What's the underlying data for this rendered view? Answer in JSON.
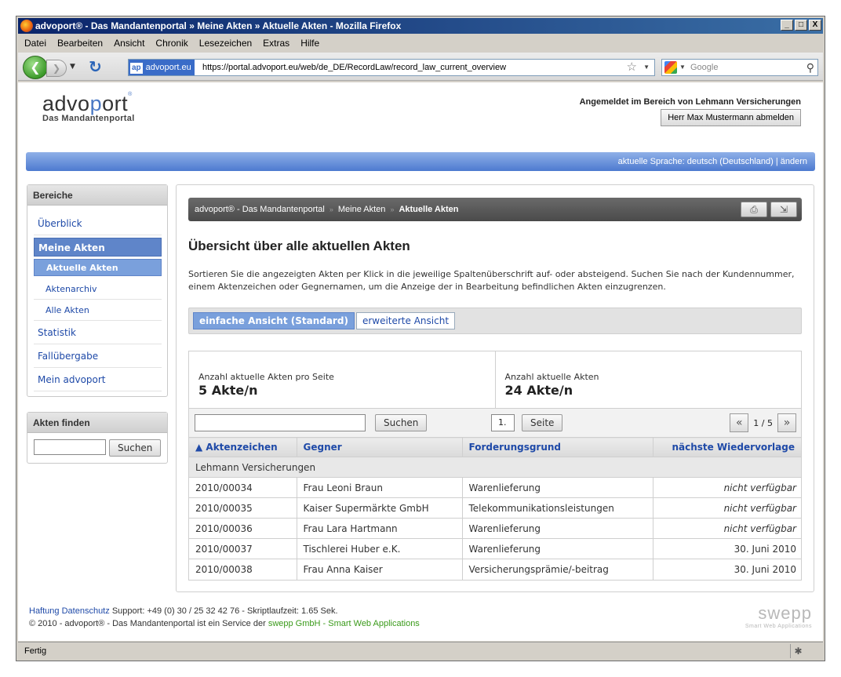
{
  "window": {
    "title": "advoport® - Das Mandantenportal  »  Meine Akten  »  Aktuelle Akten - Mozilla Firefox",
    "controls": [
      "_",
      "□",
      "X"
    ]
  },
  "menu": [
    "Datei",
    "Bearbeiten",
    "Ansicht",
    "Chronik",
    "Lesezeichen",
    "Extras",
    "Hilfe"
  ],
  "browser": {
    "site_badge": "ap",
    "site_name": "advoport.eu",
    "url": "https://portal.advoport.eu/web/de_DE/RecordLaw/record_law_current_overview",
    "search_placeholder": "Google",
    "status": "Fertig"
  },
  "header": {
    "logo_word_a": "advo",
    "logo_word_b": "p",
    "logo_word_c": "ort",
    "logo_reg": "®",
    "logo_sub": "Das Mandantenportal",
    "logged_in": "Angemeldet im Bereich von Lehmann Versicherungen",
    "logout_label": "Herr Max Mustermann abmelden",
    "language": "aktuelle Sprache: deutsch (Deutschland) | ändern"
  },
  "sidebar": {
    "areas_title": "Bereiche",
    "items": [
      {
        "label": "Überblick"
      },
      {
        "label": "Meine Akten"
      },
      {
        "label": "Aktuelle Akten"
      },
      {
        "label": "Aktenarchiv"
      },
      {
        "label": "Alle Akten"
      },
      {
        "label": "Statistik"
      },
      {
        "label": "Fallübergabe"
      },
      {
        "label": "Mein advoport"
      }
    ],
    "finder_title": "Akten finden",
    "finder_button": "Suchen"
  },
  "main": {
    "breadcrumb": [
      "advoport® - Das Mandantenportal",
      "Meine Akten",
      "Aktuelle Akten"
    ],
    "breadcrumb_sep": "»",
    "title": "Übersicht über alle aktuellen Akten",
    "intro": "Sortieren Sie die angezeigten Akten per Klick in die jeweilige Spaltenüberschrift auf- oder absteigend. Suchen Sie nach der Kundennummer, einem Aktenzeichen oder Gegnernamen, um die Anzeige der in Bearbeitung befindlichen Akten einzugrenzen.",
    "tabs": [
      "einfache Ansicht (Standard)",
      "erweiterte Ansicht"
    ],
    "stats": {
      "per_page_label": "Anzahl aktuelle Akten pro Seite",
      "per_page_value": "5 Akte/n",
      "total_label": "Anzahl aktuelle Akten",
      "total_value": "24 Akte/n"
    },
    "search_button": "Suchen",
    "page_input": "1.",
    "page_button": "Seite",
    "pager_prev": "«",
    "pager_info": "1 / 5",
    "pager_next": "»",
    "columns": [
      "▲ Aktenzeichen",
      "Gegner",
      "Forderungsgrund",
      "nächste Wiedervorlage"
    ],
    "group": "Lehmann Versicherungen",
    "rows": [
      {
        "az": "2010/00034",
        "gegner": "Frau Leoni Braun",
        "grund": "Warenlieferung",
        "wv": "nicht verfügbar",
        "na": true
      },
      {
        "az": "2010/00035",
        "gegner": "Kaiser Supermärkte GmbH",
        "grund": "Telekommunikationsleistungen",
        "wv": "nicht verfügbar",
        "na": true
      },
      {
        "az": "2010/00036",
        "gegner": "Frau Lara Hartmann",
        "grund": "Warenlieferung",
        "wv": "nicht verfügbar",
        "na": true
      },
      {
        "az": "2010/00037",
        "gegner": "Tischlerei Huber e.K.",
        "grund": "Warenlieferung",
        "wv": "30. Juni 2010",
        "na": false
      },
      {
        "az": "2010/00038",
        "gegner": "Frau Anna Kaiser",
        "grund": "Versicherungsprämie/-beitrag",
        "wv": "30. Juni 2010",
        "na": false
      }
    ]
  },
  "footer": {
    "link_haftung": "Haftung",
    "link_datenschutz": "Datenschutz",
    "support": "Support: +49 (0) 30 / 25 32 42 76 - Skriptlaufzeit: 1.65 Sek.",
    "copyright": "© 2010 - advoport® - Das Mandantenportal ist ein Service der",
    "swepp_link": "swepp GmbH - Smart Web Applications",
    "swepp_logo": "swepp",
    "swepp_tagline": "Smart Web Applications"
  }
}
